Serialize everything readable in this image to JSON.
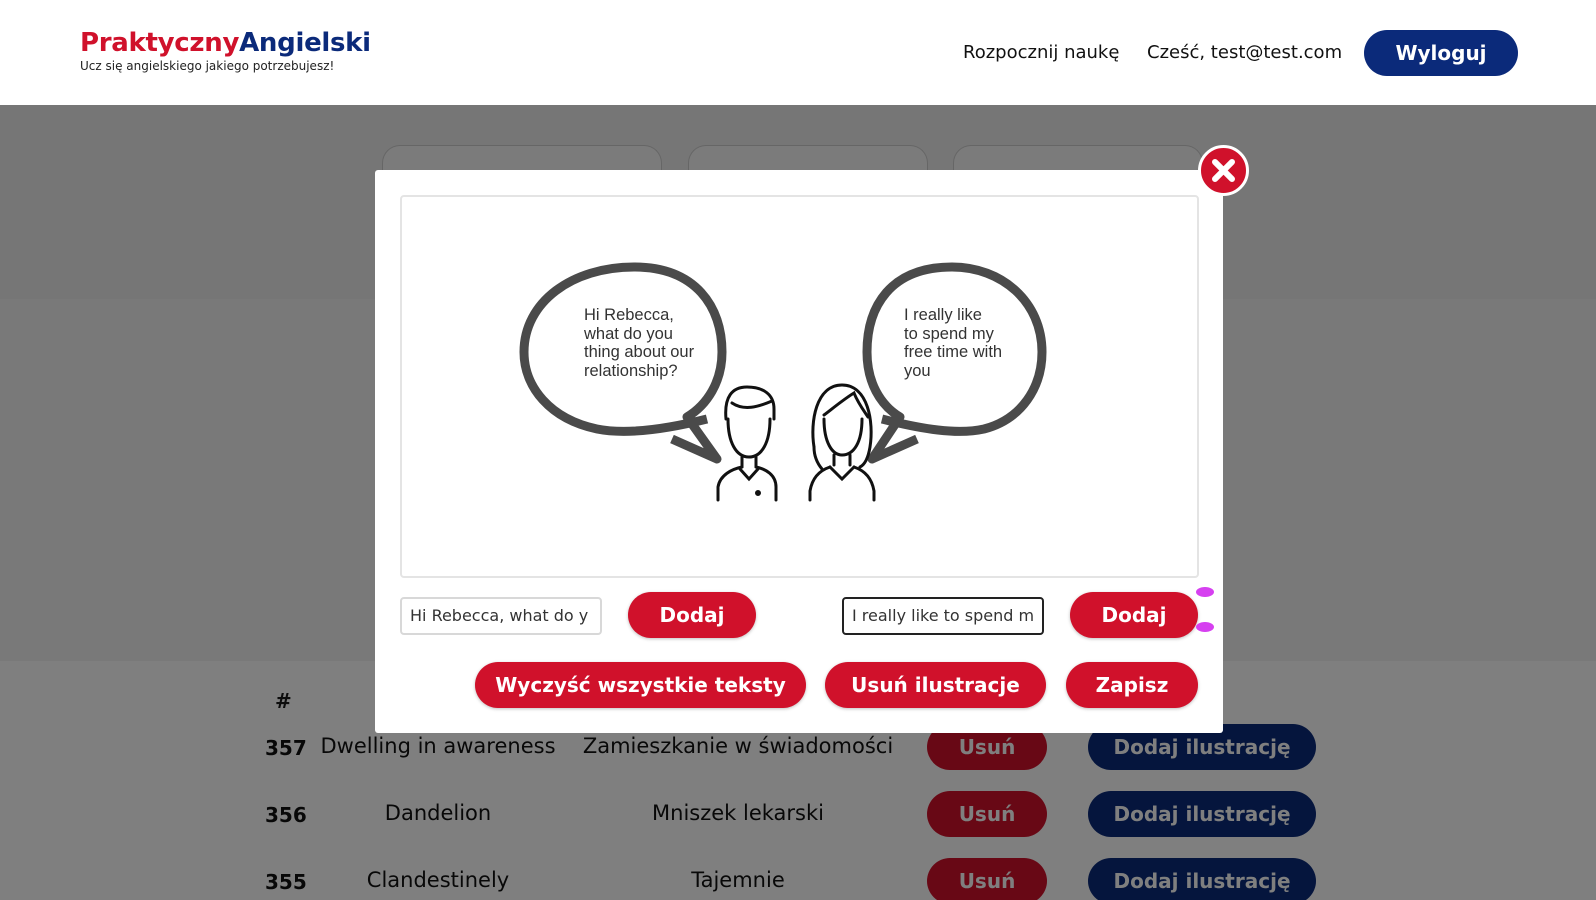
{
  "header": {
    "logo_part1": "Praktyczny",
    "logo_part2": "Angielski",
    "tagline": "Ucz się angielskiego jakiego potrzebujesz!",
    "nav_start": "Rozpocznij naukę",
    "greeting": "Cześć, test@test.com",
    "logout": "Wyloguj"
  },
  "table": {
    "hash_header": "#",
    "rows": [
      {
        "id": "357",
        "english": "Dwelling in awareness",
        "polish": "Zamieszkanie w świadomości",
        "delete": "Usuń",
        "add_illustration": "Dodaj ilustrację"
      },
      {
        "id": "356",
        "english": "Dandelion",
        "polish": "Mniszek lekarski",
        "delete": "Usuń",
        "add_illustration": "Dodaj ilustrację"
      },
      {
        "id": "355",
        "english": "Clandestinely",
        "polish": "Tajemnie",
        "delete": "Usuń",
        "add_illustration": "Dodaj ilustrację"
      }
    ]
  },
  "modal": {
    "bubble_left": [
      "Hi Rebecca,",
      "what do you",
      "thing about our",
      "relationship?"
    ],
    "bubble_right": [
      "I really like",
      "to spend my",
      "free time with",
      "you"
    ],
    "input_left_value": "Hi Rebecca, what do y",
    "input_right_value": "I really like to spend m",
    "add_left": "Dodaj",
    "add_right": "Dodaj",
    "clear_all": "Wyczyść wszystkie teksty",
    "remove_illustration": "Usuń ilustracje",
    "save": "Zapisz"
  },
  "colors": {
    "brand_red": "#d0112b",
    "brand_blue": "#0b2a7a",
    "handle_purple": "#d640f0"
  }
}
